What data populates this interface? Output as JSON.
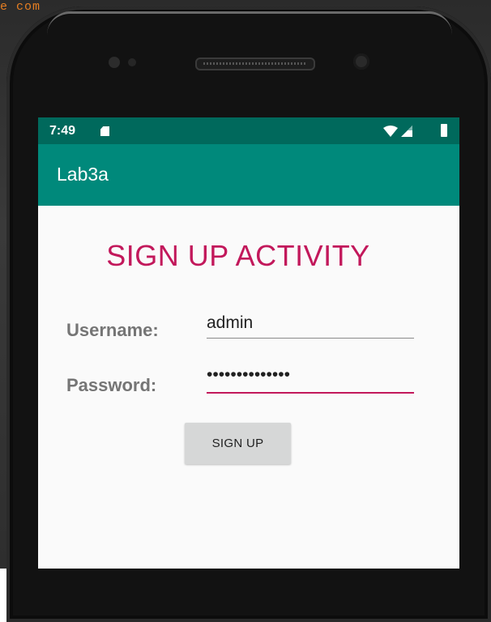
{
  "background_text": "e com",
  "status_bar": {
    "time": "7:49",
    "icons": [
      "sd-card-icon",
      "wifi-icon",
      "signal-icon",
      "battery-icon"
    ]
  },
  "app_bar": {
    "title": "Lab3a"
  },
  "form": {
    "heading": "SIGN UP ACTIVITY",
    "username_label": "Username:",
    "username_value": "admin",
    "password_label": "Password:",
    "password_value": "••••••••••••••",
    "submit_label": "SIGN UP"
  },
  "colors": {
    "status_bar": "#00695c",
    "app_bar": "#00897b",
    "accent": "#c2185b",
    "screen_bg": "#fafafa",
    "button_bg": "#d6d7d7"
  }
}
